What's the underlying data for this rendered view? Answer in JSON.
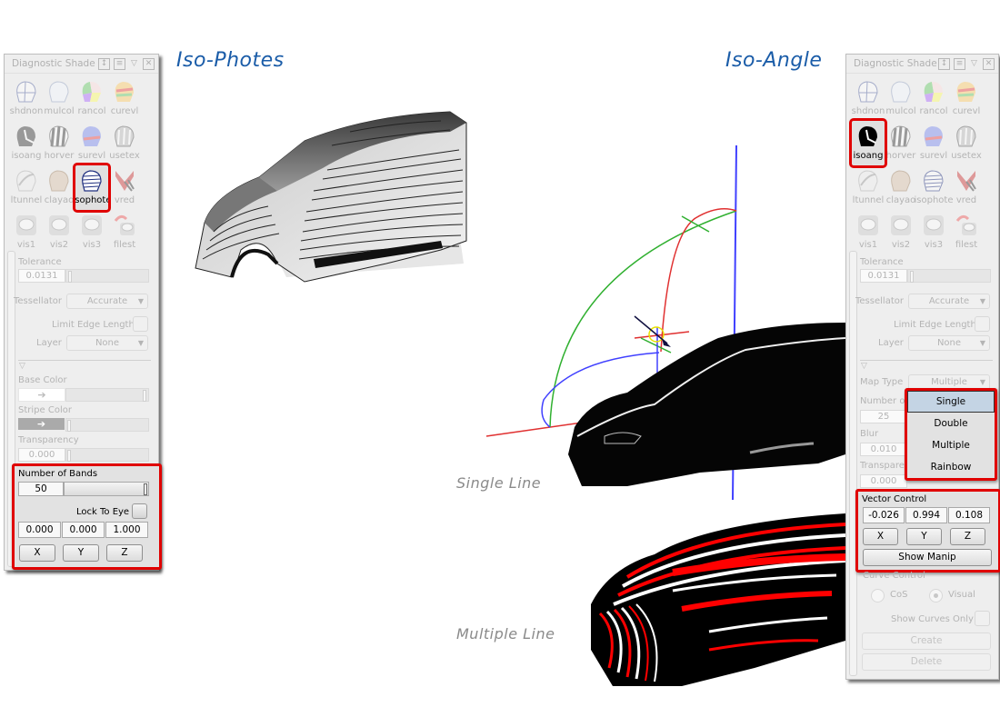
{
  "headings": {
    "left": "Iso-Photes",
    "right": "Iso-Angle",
    "single_caption": "Single Line",
    "multiple_caption": "Multiple Line"
  },
  "colors": {
    "highlight": "#e00000",
    "heading": "#1a5ca8",
    "caption": "#8a8a8a",
    "axis_x": "#e03030",
    "axis_y": "#30b030",
    "axis_z": "#4040ff",
    "dropdown_active": "#c4d4e4"
  },
  "left_panel": {
    "title": "Diagnostic Shade",
    "title_icons": [
      "resize-icon",
      "menu-icon",
      "collapse-icon",
      "close-icon"
    ],
    "shade_modes": [
      {
        "label": "shdnon",
        "icon": "shade-none-icon"
      },
      {
        "label": "mulcol",
        "icon": "multi-color-icon"
      },
      {
        "label": "rancol",
        "icon": "random-color-icon"
      },
      {
        "label": "curevl",
        "icon": "curvature-eval-icon"
      },
      {
        "label": "isoang",
        "icon": "iso-angle-icon"
      },
      {
        "label": "horver",
        "icon": "horizontal-vertical-icon"
      },
      {
        "label": "surevl",
        "icon": "surface-eval-icon"
      },
      {
        "label": "usetex",
        "icon": "use-texture-icon"
      },
      {
        "label": "ltunnel",
        "icon": "light-tunnel-icon"
      },
      {
        "label": "clayao",
        "icon": "clay-ao-icon"
      },
      {
        "label": "isophote",
        "icon": "isophote-icon",
        "selected": true
      },
      {
        "label": "vred",
        "icon": "vred-icon"
      },
      {
        "label": "vis1",
        "icon": "vis-preset-icon"
      },
      {
        "label": "vis2",
        "icon": "vis-preset-icon"
      },
      {
        "label": "vis3",
        "icon": "vis-preset-icon"
      },
      {
        "label": "filest",
        "icon": "file-state-icon"
      }
    ],
    "tolerance_label": "Tolerance",
    "tolerance_value": "0.0131",
    "tessellator_label": "Tessellator",
    "tessellator_value": "Accurate",
    "limit_edge_label": "Limit Edge Length",
    "layer_label": "Layer",
    "layer_value": "None",
    "base_color_label": "Base Color",
    "stripe_color_label": "Stripe Color",
    "transparency_label": "Transparency",
    "transparency_value": "0.000",
    "bands_label": "Number of Bands",
    "bands_value": "50",
    "lock_to_eye_label": "Lock To Eye",
    "vector": [
      "0.000",
      "0.000",
      "1.000"
    ],
    "axis_buttons": [
      "X",
      "Y",
      "Z"
    ]
  },
  "right_panel": {
    "title": "Diagnostic Shade",
    "title_icons": [
      "resize-icon",
      "menu-icon",
      "collapse-icon",
      "close-icon"
    ],
    "shade_modes": [
      {
        "label": "shdnon",
        "icon": "shade-none-icon"
      },
      {
        "label": "mulcol",
        "icon": "multi-color-icon"
      },
      {
        "label": "rancol",
        "icon": "random-color-icon"
      },
      {
        "label": "curevl",
        "icon": "curvature-eval-icon"
      },
      {
        "label": "isoang",
        "icon": "iso-angle-icon",
        "selected": true
      },
      {
        "label": "horver",
        "icon": "horizontal-vertical-icon"
      },
      {
        "label": "surevl",
        "icon": "surface-eval-icon"
      },
      {
        "label": "usetex",
        "icon": "use-texture-icon"
      },
      {
        "label": "ltunnel",
        "icon": "light-tunnel-icon"
      },
      {
        "label": "clayao",
        "icon": "clay-ao-icon"
      },
      {
        "label": "isophote",
        "icon": "isophote-icon"
      },
      {
        "label": "vred",
        "icon": "vred-icon"
      },
      {
        "label": "vis1",
        "icon": "vis-preset-icon"
      },
      {
        "label": "vis2",
        "icon": "vis-preset-icon"
      },
      {
        "label": "vis3",
        "icon": "vis-preset-icon"
      },
      {
        "label": "filest",
        "icon": "file-state-icon"
      }
    ],
    "tolerance_label": "Tolerance",
    "tolerance_value": "0.0131",
    "tessellator_label": "Tessellator",
    "tessellator_value": "Accurate",
    "limit_edge_label": "Limit Edge Length",
    "layer_label": "Layer",
    "layer_value": "None",
    "map_type_label": "Map Type",
    "map_type_value": "Multiple",
    "map_type_options": [
      "Single",
      "Double",
      "Multiple",
      "Rainbow"
    ],
    "map_type_highlighted": "Single",
    "number_label": "Number of",
    "number_value": "25",
    "blur_label": "Blur",
    "blur_value": "0.010",
    "transparency_label": "Transparency",
    "transparency_value": "0.000",
    "vector_control_label": "Vector Control",
    "vector": [
      "-0.026",
      "0.994",
      "0.108"
    ],
    "axis_buttons": [
      "X",
      "Y",
      "Z"
    ],
    "show_manip_label": "Show Manip",
    "curve_control_label": "Curve Control",
    "radio_cos": "CoS",
    "radio_visual": "Visual",
    "show_curves_only_label": "Show Curves Only",
    "create_label": "Create",
    "delete_label": "Delete"
  }
}
